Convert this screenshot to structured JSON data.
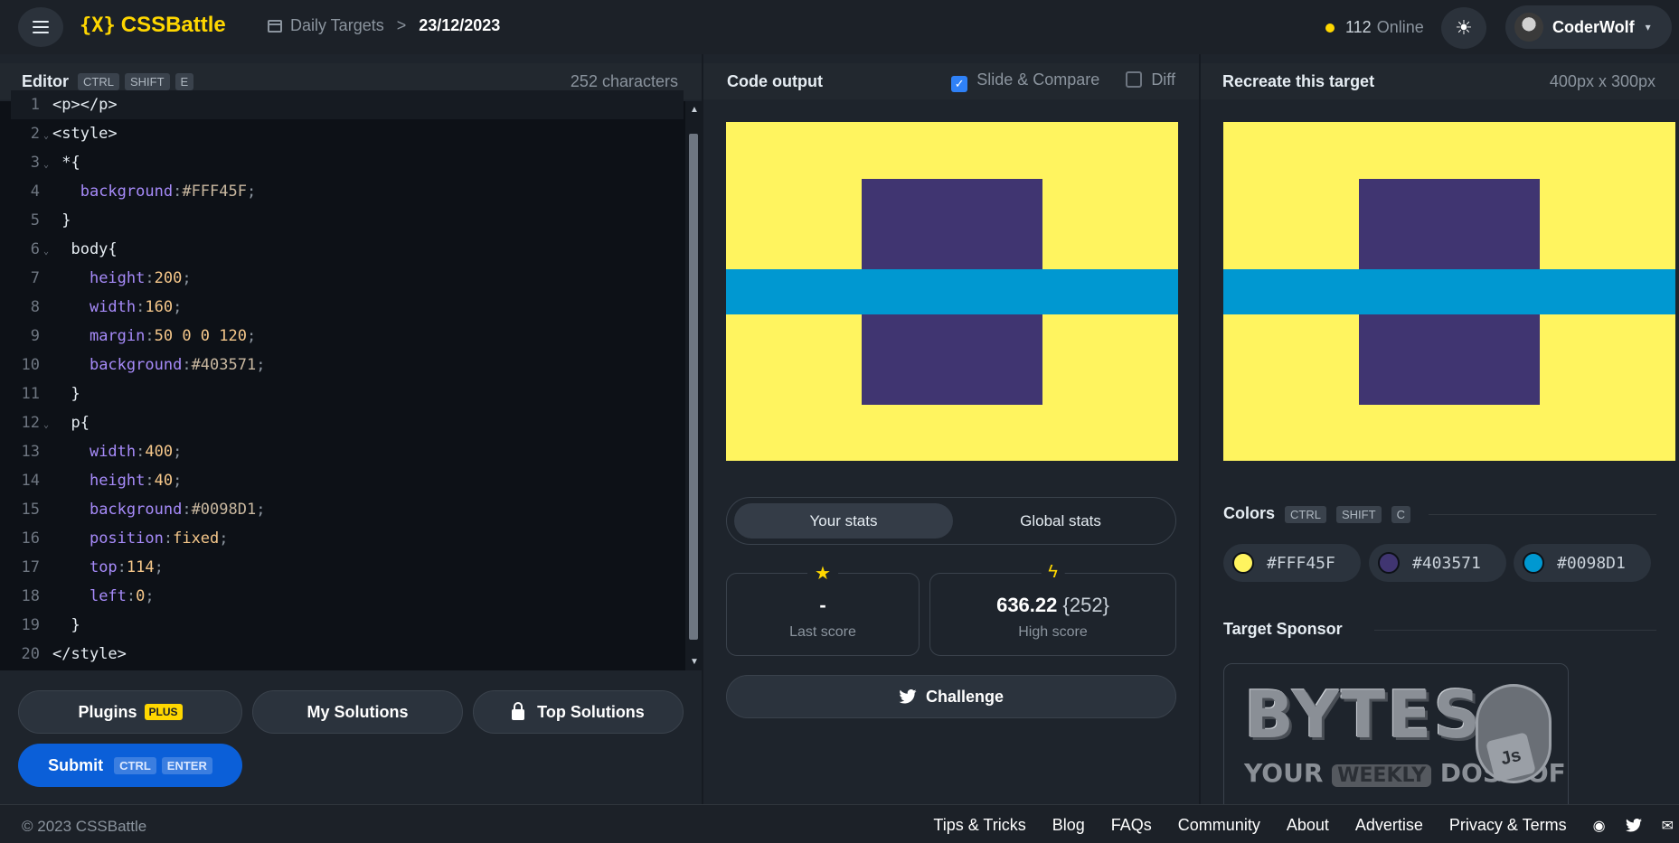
{
  "header": {
    "logo_mark": "{X}",
    "logo_text": "CSSBattle",
    "breadcrumb_section": "Daily Targets",
    "breadcrumb_sep": ">",
    "breadcrumb_date": "23/12/2023",
    "online_count": "112",
    "online_label": "Online",
    "theme_icon": "☀",
    "username": "CoderWolf",
    "user_chevron": "▾"
  },
  "editor": {
    "title": "Editor",
    "shortcut": [
      "CTRL",
      "SHIFT",
      "E"
    ],
    "char_count": "252 characters",
    "lines": [
      {
        "n": "1",
        "fold": "",
        "code": "<p></p>"
      },
      {
        "n": "2",
        "fold": "⌄",
        "code": "<style>"
      },
      {
        "n": "3",
        "fold": "⌄",
        "code": " *{"
      },
      {
        "n": "4",
        "fold": "",
        "code": "   background:#FFF45F;"
      },
      {
        "n": "5",
        "fold": "",
        "code": " }"
      },
      {
        "n": "6",
        "fold": "⌄",
        "code": "  body{"
      },
      {
        "n": "7",
        "fold": "",
        "code": "    height:200;"
      },
      {
        "n": "8",
        "fold": "",
        "code": "    width:160;"
      },
      {
        "n": "9",
        "fold": "",
        "code": "    margin:50 0 0 120;"
      },
      {
        "n": "10",
        "fold": "",
        "code": "    background:#403571;"
      },
      {
        "n": "11",
        "fold": "",
        "code": "  }"
      },
      {
        "n": "12",
        "fold": "⌄",
        "code": "  p{"
      },
      {
        "n": "13",
        "fold": "",
        "code": "    width:400;"
      },
      {
        "n": "14",
        "fold": "",
        "code": "    height:40;"
      },
      {
        "n": "15",
        "fold": "",
        "code": "    background:#0098D1;"
      },
      {
        "n": "16",
        "fold": "",
        "code": "    position:fixed;"
      },
      {
        "n": "17",
        "fold": "",
        "code": "    top:114;"
      },
      {
        "n": "18",
        "fold": "",
        "code": "    left:0;"
      },
      {
        "n": "19",
        "fold": "",
        "code": "  }"
      },
      {
        "n": "20",
        "fold": "",
        "code": "</style>"
      }
    ],
    "plugins_label": "Plugins",
    "plugins_badge": "PLUS",
    "my_solutions_label": "My Solutions",
    "top_solutions_label": "Top Solutions",
    "submit_label": "Submit",
    "submit_shortcut": [
      "CTRL",
      "ENTER"
    ]
  },
  "output": {
    "title": "Code output",
    "slide_compare_label": "Slide & Compare",
    "slide_compare_checked": true,
    "diff_label": "Diff",
    "diff_checked": false
  },
  "stats": {
    "tab_your": "Your stats",
    "tab_global": "Global stats",
    "last_score_value": "-",
    "last_score_label": "Last score",
    "high_score_value": "636.22",
    "high_score_chars": "{252}",
    "high_score_label": "High score",
    "star_icon": "★",
    "bolt_icon": "ϟ",
    "challenge_label": "Challenge",
    "challenge_icon": "twitter-bird"
  },
  "target": {
    "title": "Recreate this target",
    "size": "400px x 300px",
    "colors_title": "Colors",
    "colors_shortcut": [
      "CTRL",
      "SHIFT",
      "C"
    ],
    "colors": [
      "#FFF45F",
      "#403571",
      "#0098D1"
    ],
    "sponsor_title": "Target Sponsor",
    "sponsor_big": "BYTES",
    "sponsor_small_1": "YOUR",
    "sponsor_small_2": "WEEKLY",
    "sponsor_small_3": "DOSE OF",
    "sponsor_js": "Js"
  },
  "canvas_colors": {
    "background": "#FFF45F",
    "body": "#403571",
    "bar": "#0098D1"
  },
  "footer": {
    "copyright": "© 2023 CSSBattle",
    "links": [
      "Tips & Tricks",
      "Blog",
      "FAQs",
      "Community",
      "About",
      "Advertise",
      "Privacy & Terms"
    ]
  }
}
